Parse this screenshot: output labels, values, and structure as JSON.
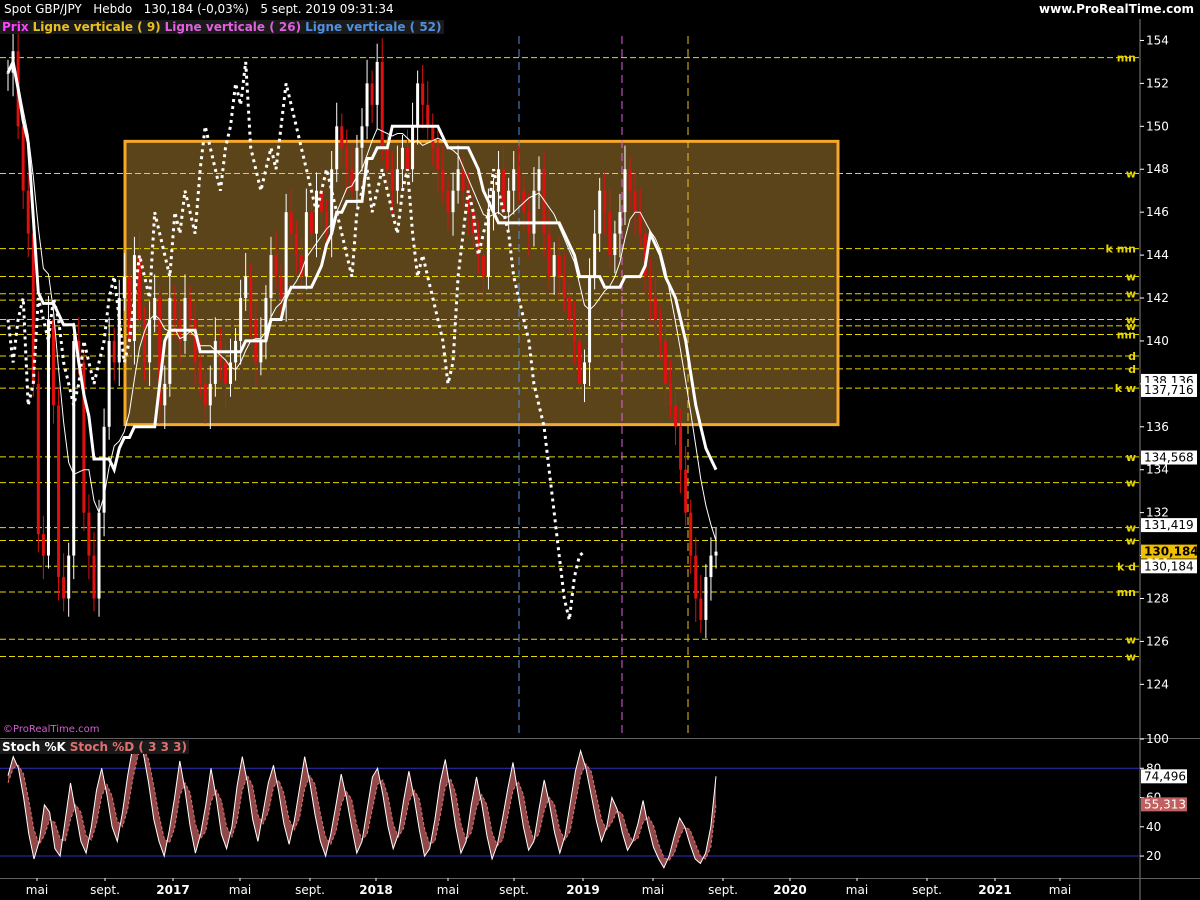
{
  "header": {
    "instrument": "Spot GBP/JPY",
    "period": "Hebdo",
    "price_change": "130,184 (-0,03%)",
    "datetime": "5 sept. 2019 09:31:34",
    "site": "www.ProRealTime.com"
  },
  "legend": {
    "prix": "Prix",
    "line9": "Ligne verticale ( 9)",
    "line26": "Ligne verticale ( 26)",
    "line52": "Ligne verticale ( 52)",
    "stoch_k": "Stoch %K",
    "stoch_d": "Stoch %D ( 3 3 3)"
  },
  "watermark": "©ProRealTime.com",
  "colors": {
    "background": "#000000",
    "hline": "#e8d800",
    "box_fill": "#6b4f1e",
    "box_stroke": "#f5a82a",
    "candle_up": "#ffffff",
    "candle_down": "#e01010",
    "vline9": "#e8c020",
    "vline26": "#e060e0",
    "vline52": "#5090e0",
    "stoch_k": "#ffffff",
    "stoch_d_fill": "#c06060",
    "stoch_band": "#3030c0"
  },
  "chart_data": [
    {
      "type": "candlestick",
      "title": "Spot GBP/JPY",
      "ylim": [
        121.5,
        155
      ],
      "y_ticks": [
        124,
        126,
        128,
        130,
        132,
        134,
        136,
        138,
        140,
        142,
        144,
        146,
        148,
        150,
        152,
        154
      ],
      "x_ticks": [
        "mai",
        "sept.",
        "2017",
        "mai",
        "sept.",
        "2018",
        "mai",
        "sept.",
        "2019",
        "mai",
        "sept.",
        "2020",
        "mai",
        "sept.",
        "2021",
        "mai"
      ],
      "price_labels": [
        {
          "value": 138.136,
          "text": "138,136"
        },
        {
          "value": 137.716,
          "text": "137,716"
        },
        {
          "value": 134.568,
          "text": "134,568"
        },
        {
          "value": 131.419,
          "text": "131,419"
        },
        {
          "value": 130.184,
          "text": "130,184",
          "highlight": true
        },
        {
          "value": 129.5,
          "text": "130,184"
        }
      ],
      "horizontal_levels": [
        {
          "value": 153.2,
          "label": "mn"
        },
        {
          "value": 147.8,
          "label": "w"
        },
        {
          "value": 144.3,
          "label": "k mn"
        },
        {
          "value": 143.0,
          "label": "w"
        },
        {
          "value": 142.2,
          "label": "w"
        },
        {
          "value": 141.9,
          "label": ""
        },
        {
          "value": 141.0,
          "label": "w"
        },
        {
          "value": 140.7,
          "label": "w"
        },
        {
          "value": 140.3,
          "label": "mn"
        },
        {
          "value": 139.3,
          "label": "d"
        },
        {
          "value": 138.7,
          "label": "d"
        },
        {
          "value": 137.8,
          "label": "k w"
        },
        {
          "value": 134.6,
          "label": "w"
        },
        {
          "value": 133.4,
          "label": "w"
        },
        {
          "value": 131.3,
          "label": "w"
        },
        {
          "value": 130.7,
          "label": "w"
        },
        {
          "value": 129.5,
          "label": "k d"
        },
        {
          "value": 128.3,
          "label": "mn"
        },
        {
          "value": 126.1,
          "label": "w"
        },
        {
          "value": 125.3,
          "label": "w"
        }
      ],
      "box": {
        "y_top": 149.3,
        "y_bottom": 136.1
      },
      "close_series": [
        152.5,
        153.5,
        150,
        147,
        145,
        138,
        131,
        130,
        141,
        137,
        129,
        128,
        130,
        140,
        139,
        132,
        130,
        128,
        132,
        136,
        140,
        139,
        142,
        143,
        140,
        144,
        141,
        139,
        141,
        142,
        137,
        138,
        142,
        141,
        140,
        142,
        141,
        139,
        138,
        137,
        138,
        140,
        139,
        138,
        139,
        140,
        142,
        143,
        141,
        139,
        140,
        142,
        144,
        143,
        142,
        146,
        145,
        144,
        143,
        146,
        145,
        147,
        146,
        145,
        148,
        150,
        149,
        148,
        147,
        149,
        150,
        152,
        151,
        153,
        149,
        148,
        147,
        148,
        149,
        148,
        150,
        152,
        151,
        150,
        149,
        148,
        147,
        146,
        147,
        148,
        147,
        146,
        145,
        144,
        143,
        146,
        147,
        148,
        146,
        147,
        148,
        147,
        146,
        145,
        147,
        148,
        145,
        143,
        144,
        143,
        142,
        141,
        140,
        138,
        139,
        143,
        145,
        147,
        146,
        144,
        145,
        146,
        148,
        147,
        146,
        145,
        143,
        142,
        141,
        140,
        138,
        137,
        136,
        134,
        132,
        130,
        128,
        127,
        129,
        130,
        130.184
      ]
    },
    {
      "type": "line",
      "title": "Stoch %K / Stoch %D ( 3 3 3)",
      "ylim": [
        5,
        100
      ],
      "y_ticks": [
        20,
        40,
        60,
        80,
        100
      ],
      "bands": [
        20,
        80
      ],
      "series": [
        {
          "name": "Stoch %K",
          "values": [
            75,
            88,
            80,
            60,
            35,
            18,
            30,
            55,
            50,
            25,
            20,
            45,
            70,
            50,
            30,
            22,
            40,
            65,
            80,
            62,
            40,
            30,
            50,
            75,
            95,
            97,
            90,
            70,
            45,
            30,
            20,
            38,
            60,
            85,
            65,
            40,
            22,
            35,
            55,
            80,
            60,
            35,
            25,
            40,
            68,
            88,
            70,
            45,
            30,
            50,
            70,
            82,
            64,
            42,
            28,
            44,
            66,
            88,
            70,
            48,
            30,
            20,
            35,
            55,
            76,
            60,
            40,
            22,
            30,
            52,
            74,
            80,
            62,
            40,
            25,
            35,
            58,
            78,
            60,
            38,
            20,
            25,
            45,
            70,
            86,
            64,
            40,
            22,
            30,
            55,
            74,
            56,
            34,
            18,
            28,
            46,
            66,
            84,
            62,
            40,
            24,
            30,
            52,
            72,
            56,
            36,
            22,
            34,
            56,
            78,
            92,
            80,
            62,
            44,
            30,
            40,
            60,
            52,
            36,
            24,
            30,
            42,
            58,
            40,
            26,
            18,
            12,
            20,
            34,
            46,
            40,
            28,
            18,
            15,
            22,
            40,
            74.496
          ]
        },
        {
          "name": "Stoch %D",
          "values": [
            70,
            80,
            82,
            76,
            58,
            38,
            28,
            34,
            45,
            43,
            32,
            30,
            45,
            55,
            50,
            34,
            31,
            42,
            61,
            69,
            61,
            44,
            40,
            52,
            73,
            89,
            94,
            86,
            68,
            48,
            32,
            29,
            39,
            61,
            70,
            63,
            42,
            32,
            37,
            57,
            65,
            58,
            40,
            33,
            44,
            65,
            75,
            68,
            48,
            42,
            50,
            67,
            72,
            63,
            45,
            38,
            46,
            66,
            75,
            69,
            49,
            33,
            28,
            37,
            55,
            64,
            59,
            41,
            31,
            35,
            52,
            69,
            72,
            61,
            42,
            33,
            39,
            57,
            65,
            59,
            39,
            28,
            30,
            47,
            67,
            73,
            63,
            42,
            31,
            36,
            53,
            62,
            55,
            36,
            27,
            31,
            47,
            65,
            71,
            62,
            42,
            31,
            35,
            51,
            60,
            55,
            38,
            31,
            37,
            56,
            75,
            83,
            78,
            62,
            45,
            38,
            43,
            51,
            49,
            37,
            30,
            32,
            43,
            47,
            41,
            28,
            19,
            17,
            22,
            33,
            40,
            38,
            29,
            20,
            18,
            26,
            55.313
          ]
        }
      ],
      "price_labels": [
        {
          "value": 74.496,
          "text": "74,496"
        },
        {
          "value": 55.313,
          "text": "55,313"
        }
      ]
    }
  ]
}
